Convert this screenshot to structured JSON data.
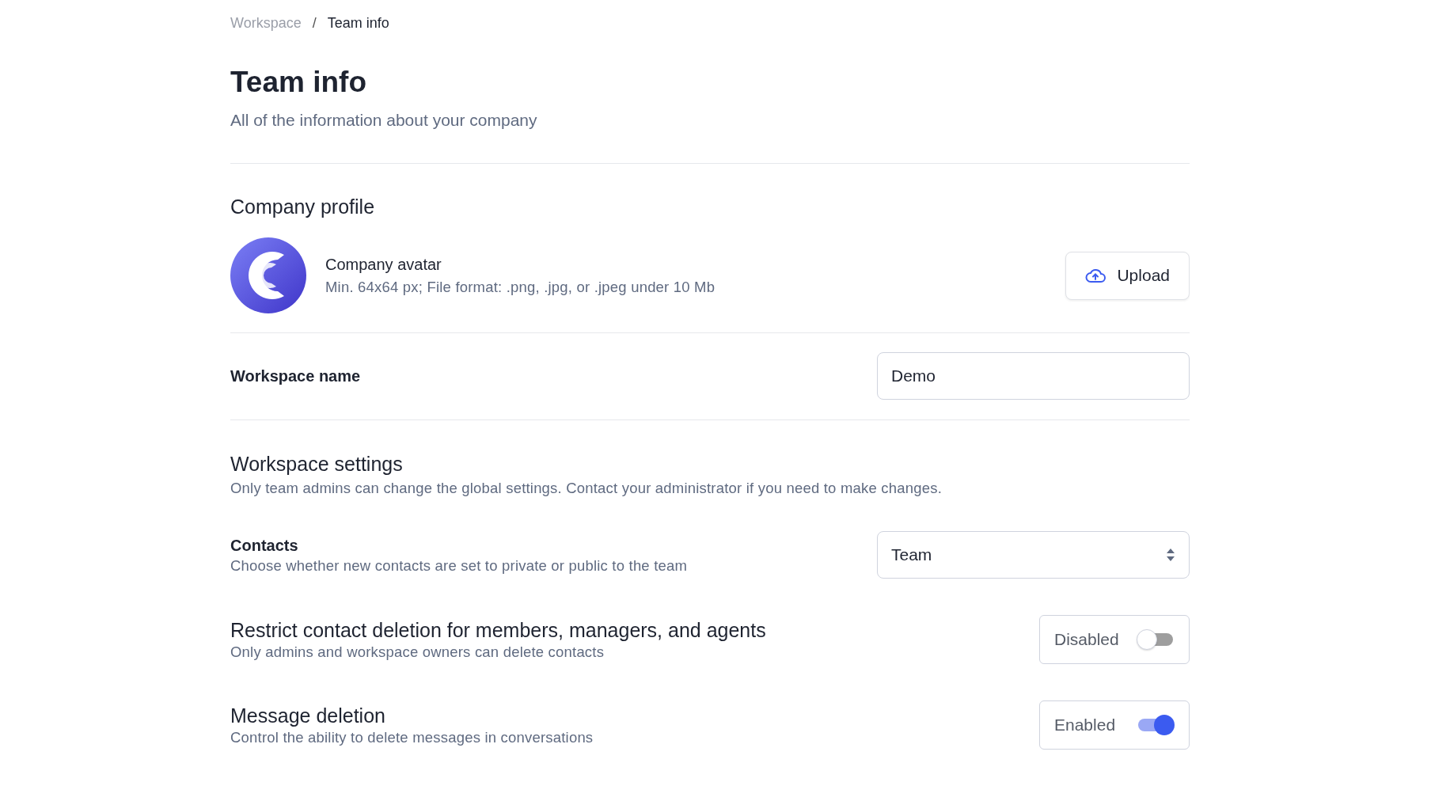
{
  "breadcrumb": [
    {
      "label": "Workspace",
      "selected": false
    },
    {
      "label": "/",
      "kind": "separator"
    },
    {
      "label": "Team info",
      "selected": true
    }
  ],
  "header": {
    "title": "Team info",
    "subtitle": "All of the information about your company"
  },
  "company_profile": {
    "heading": "Company profile",
    "avatar_label": "Company avatar",
    "avatar_hint": "Min. 64x64 px; File format: .png, .jpg, or .jpeg under 10 Mb",
    "upload_button": "Upload"
  },
  "workspace_name": {
    "label": "Workspace name",
    "value": "Demo"
  },
  "workspace_settings": {
    "heading": "Workspace settings",
    "description": "Only team admins can change the global settings. Contact your administrator if you need to make changes."
  },
  "settings": [
    {
      "kind": "select",
      "label": "Contacts",
      "description": "Choose whether new contacts are set to private or public to the team",
      "value": "Team"
    },
    {
      "kind": "toggle",
      "label": "Restrict contact deletion for members, managers, and agents",
      "description": "Only admins and workspace owners can delete contacts",
      "state_label": "Disabled",
      "on": false
    },
    {
      "kind": "toggle",
      "label": "Message deletion",
      "description": "Control the ability to delete messages in conversations",
      "state_label": "Enabled",
      "on": true
    }
  ]
}
